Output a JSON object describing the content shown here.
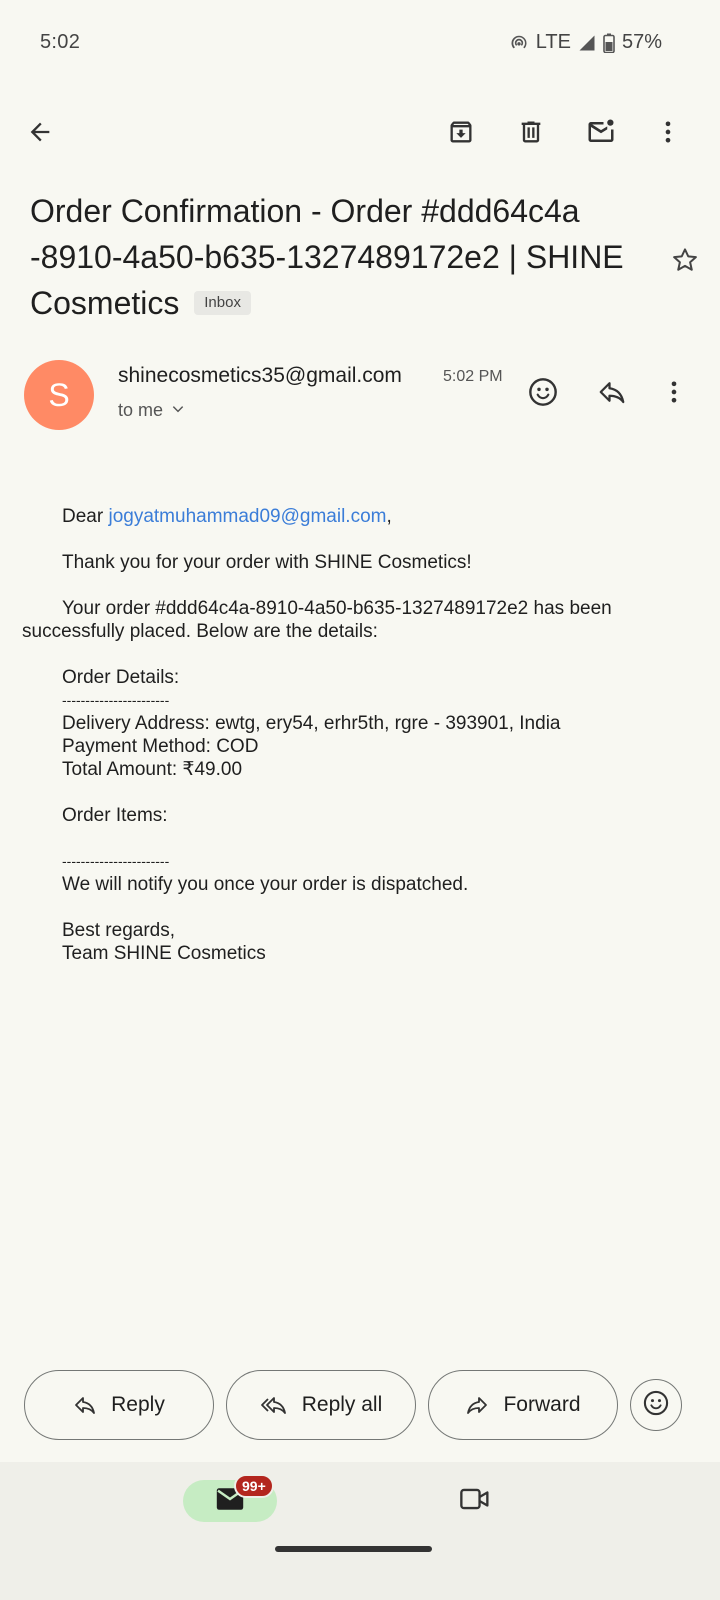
{
  "status": {
    "time": "5:02",
    "network": "LTE",
    "battery": "57%"
  },
  "email": {
    "subject": "Order Confirmation - Order #ddd64c4a -8910-4a50-b635-1327489172e2 | SHINE Cosmetics",
    "label": "Inbox",
    "avatar_letter": "S",
    "sender": "shinecosmetics35@gmail.com",
    "time": "5:02 PM",
    "recipient": "to me",
    "body": {
      "greeting_prefix": "Dear ",
      "greeting_email": "jogyatmuhammad09@gmail.com",
      "greeting_suffix": ",",
      "thanks": "Thank you for your order with SHINE Cosmetics!",
      "order_line_1": "Your order #ddd64c4a-8910-4a50-b635-1327489172e2 has been",
      "order_line_2": "successfully placed. Below are the details:",
      "details_title": "Order Details:",
      "divider": "-----------------------",
      "address": "Delivery Address: ewtg, ery54, erhr5th, rgre - 393901, India",
      "payment": "Payment Method: COD",
      "total": "Total Amount: ₹49.00",
      "items_title": "Order Items:",
      "notify": "We will notify you once your order is dispatched.",
      "regards": "Best regards,",
      "team": "Team SHINE Cosmetics"
    }
  },
  "actions": {
    "reply": "Reply",
    "reply_all": "Reply all",
    "forward": "Forward"
  },
  "nav": {
    "mail_badge": "99+"
  },
  "icons": [
    "back-arrow-icon",
    "archive-icon",
    "delete-icon",
    "mark-unread-icon",
    "more-vert-icon",
    "star-icon",
    "emoji-icon",
    "reply-icon",
    "reply-all-icon",
    "forward-icon",
    "mail-icon",
    "video-icon"
  ]
}
